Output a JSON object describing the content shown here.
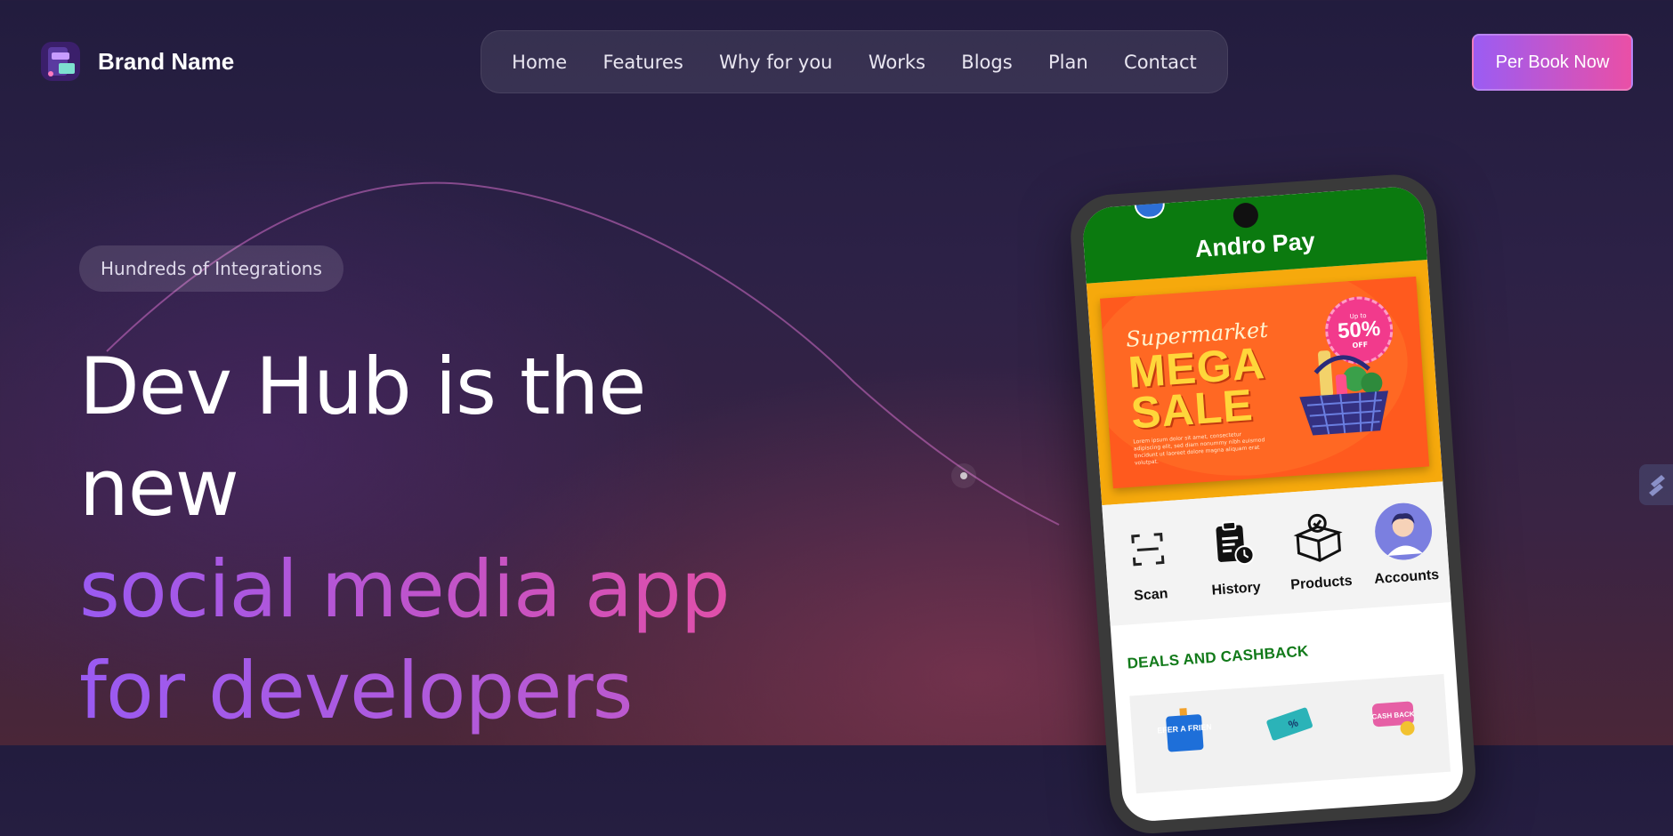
{
  "brand": {
    "name": "Brand Name"
  },
  "nav": {
    "items": [
      "Home",
      "Features",
      "Why for you",
      "Works",
      "Blogs",
      "Plan",
      "Contact"
    ]
  },
  "cta": {
    "label": "Per Book Now"
  },
  "hero": {
    "badge": "Hundreds of Integrations",
    "line1": "Dev Hub is the",
    "line2": "new",
    "line3": "social media app",
    "line4": "for developers"
  },
  "phone": {
    "app_title": "Andro Pay",
    "banner": {
      "script": "Supermarket",
      "headline1": "MEGA",
      "headline2": "SALE",
      "fine_print": "Lorem ipsum dolor sit amet, consectetur adipiscing elit, sed diam nonummy nibh euismod tincidunt ut laoreet dolore magna aliquam erat volutpat.",
      "badge_top": "Up to",
      "badge_value": "50%",
      "badge_bottom": "OFF"
    },
    "actions": [
      {
        "label": "Scan",
        "icon": "scan-icon"
      },
      {
        "label": "History",
        "icon": "history-icon"
      },
      {
        "label": "Products",
        "icon": "products-box-icon"
      },
      {
        "label": "Accounts",
        "icon": "account-avatar-icon"
      }
    ],
    "deals_title": "DEALS AND CASHBACK",
    "deals": [
      {
        "icon": "refer-a-friend-icon",
        "text": "REFER A FRIEND"
      },
      {
        "icon": "discount-coupon-icon",
        "text": "%"
      },
      {
        "icon": "cashback-icon",
        "text": "CASH BACK"
      }
    ]
  },
  "colors": {
    "accent_start": "#9b5cf3",
    "accent_end": "#ea4fa6",
    "app_green": "#0b7a0f",
    "app_yellow": "#f6a90c"
  }
}
